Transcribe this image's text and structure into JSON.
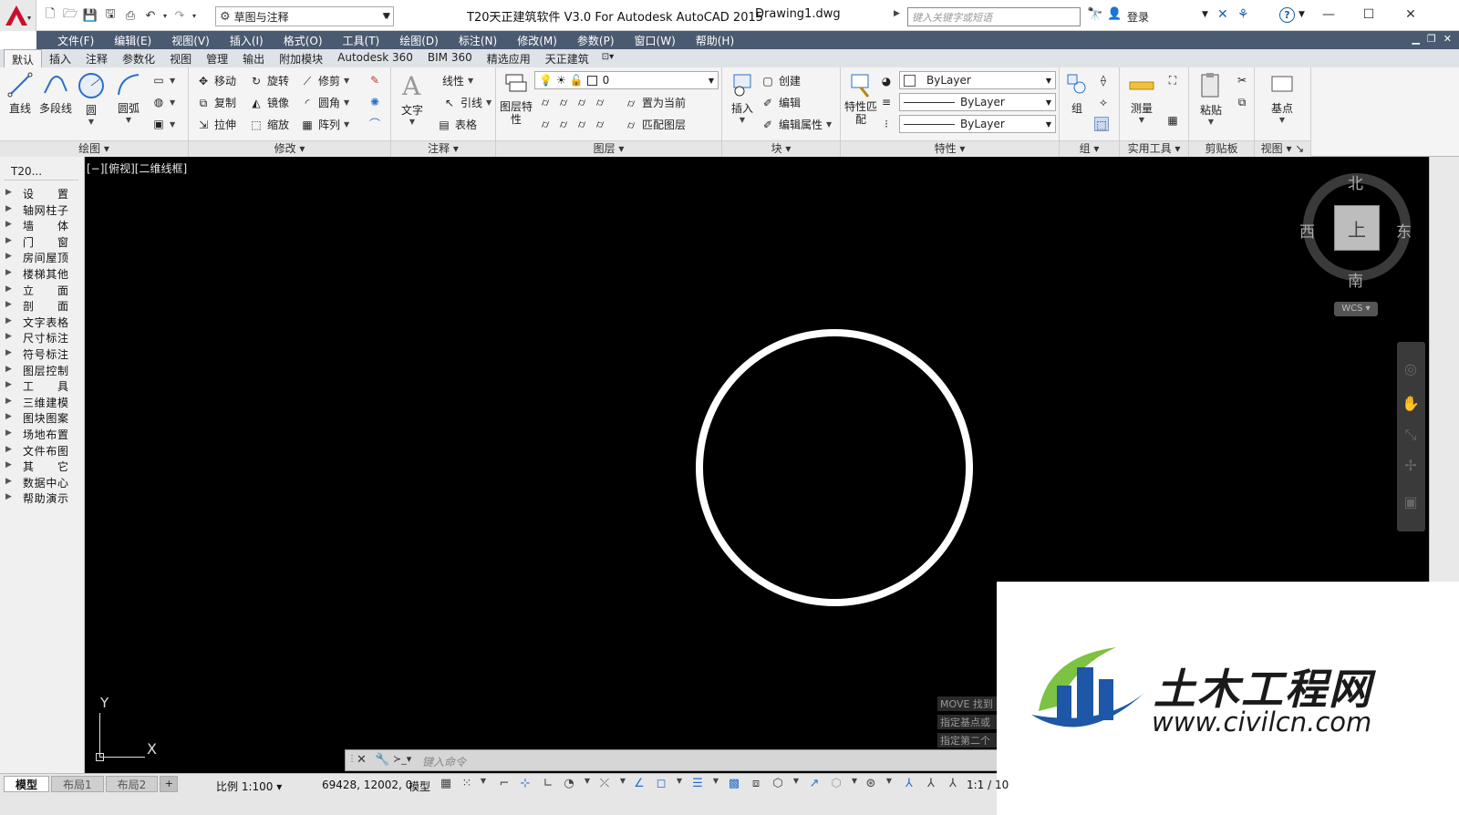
{
  "app": {
    "title": "T20天正建筑软件 V3.0 For Autodesk AutoCAD 2015",
    "document": "Drawing1.dwg",
    "workspace": "草图与注释",
    "search_placeholder": "键入关键字或短语",
    "login_label": "登录",
    "accent": "#4a5a70"
  },
  "menu": [
    "文件(F)",
    "编辑(E)",
    "视图(V)",
    "插入(I)",
    "格式(O)",
    "工具(T)",
    "绘图(D)",
    "标注(N)",
    "修改(M)",
    "参数(P)",
    "窗口(W)",
    "帮助(H)"
  ],
  "ribbon_tabs": [
    "默认",
    "插入",
    "注释",
    "参数化",
    "视图",
    "管理",
    "输出",
    "附加模块",
    "Autodesk 360",
    "BIM 360",
    "精选应用",
    "天正建筑"
  ],
  "ribbon": {
    "draw": {
      "title": "绘图",
      "line": "直线",
      "polyline": "多段线",
      "circle": "圆",
      "arc": "圆弧"
    },
    "modify": {
      "title": "修改",
      "move": "移动",
      "rotate": "旋转",
      "trim": "修剪",
      "copy": "复制",
      "mirror": "镜像",
      "fillet": "圆角",
      "stretch": "拉伸",
      "scale": "缩放",
      "array": "阵列"
    },
    "annotation": {
      "title": "注释",
      "text": "文字",
      "linetype": "线性",
      "leader": "引线",
      "table": "表格"
    },
    "layers": {
      "title": "图层",
      "props": "图层特性",
      "current_layer": "0",
      "set_current": "置为当前",
      "match": "匹配图层"
    },
    "block": {
      "title": "块",
      "insert": "插入",
      "create": "创建",
      "edit": "编辑",
      "edit_attr": "编辑属性"
    },
    "properties": {
      "title": "特性",
      "match": "特性匹配",
      "color": "ByLayer",
      "lineweight": "ByLayer",
      "linetype": "ByLayer"
    },
    "group": {
      "title": "组",
      "group": "组"
    },
    "utilities": {
      "title": "实用工具",
      "measure": "测量"
    },
    "clipboard": {
      "title": "剪贴板",
      "paste": "粘贴"
    },
    "view": {
      "title": "视图",
      "base": "基点"
    }
  },
  "palette": {
    "title": "T20...",
    "items": [
      "设　　置",
      "轴网柱子",
      "墙　　体",
      "门　　窗",
      "房间屋顶",
      "楼梯其他",
      "立　　面",
      "剖　　面",
      "文字表格",
      "尺寸标注",
      "符号标注",
      "图层控制",
      "工　　具",
      "三维建模",
      "图块图案",
      "场地布置",
      "文件布图",
      "其　　它",
      "数据中心",
      "帮助演示"
    ]
  },
  "viewport": {
    "label": "[−][俯视][二维线框]",
    "compass": {
      "north": "北",
      "south": "南",
      "east": "东",
      "west": "西",
      "face": "上"
    },
    "wcs": "WCS",
    "ucs_x": "X",
    "ucs_y": "Y",
    "command_history": [
      "MOVE 找到",
      "指定基点或",
      "指定第二个"
    ],
    "command_placeholder": "键入命令"
  },
  "status": {
    "tabs": [
      "模型",
      "布局1",
      "布局2"
    ],
    "add_tab": "+",
    "scale": "比例 1:100",
    "coords": "69428, 12002, 0",
    "space": "模型",
    "annot_scale": "1:1 / 10"
  },
  "watermark": {
    "name": "土木工程网",
    "url": "www.civilcn.com"
  }
}
